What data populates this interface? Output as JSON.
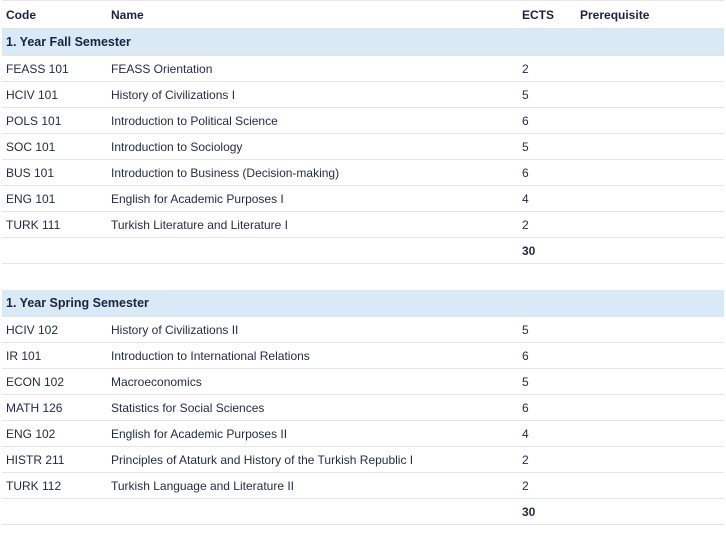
{
  "table": {
    "headers": {
      "code": "Code",
      "name": "Name",
      "ects": "ECTS",
      "prerequisite": "Prerequisite"
    },
    "semesters": [
      {
        "title": "1. Year Fall Semester",
        "courses": [
          {
            "code": "FEASS 101",
            "name": "FEASS Orientation",
            "ects": "2",
            "prerequisite": ""
          },
          {
            "code": "HCIV 101",
            "name": "History of Civilizations I",
            "ects": "5",
            "prerequisite": ""
          },
          {
            "code": "POLS 101",
            "name": "Introduction to Political Science",
            "ects": "6",
            "prerequisite": ""
          },
          {
            "code": "SOC 101",
            "name": "Introduction to Sociology",
            "ects": "5",
            "prerequisite": ""
          },
          {
            "code": "BUS 101",
            "name": "Introduction to Business (Decision-making)",
            "ects": "6",
            "prerequisite": ""
          },
          {
            "code": "ENG 101",
            "name": "English for Academic Purposes I",
            "ects": "4",
            "prerequisite": ""
          },
          {
            "code": "TURK 111",
            "name": "Turkish Literature and Literature I",
            "ects": "2",
            "prerequisite": ""
          }
        ],
        "total_ects": "30"
      },
      {
        "title": "1. Year Spring Semester",
        "courses": [
          {
            "code": "HCIV 102",
            "name": "History of Civilizations II",
            "ects": "5",
            "prerequisite": ""
          },
          {
            "code": "IR 101",
            "name": "Introduction to International Relations",
            "ects": "6",
            "prerequisite": ""
          },
          {
            "code": "ECON 102",
            "name": "Macroeconomics",
            "ects": "5",
            "prerequisite": ""
          },
          {
            "code": "MATH 126",
            "name": "Statistics for Social Sciences",
            "ects": "6",
            "prerequisite": ""
          },
          {
            "code": "ENG 102",
            "name": "English for Academic Purposes II",
            "ects": "4",
            "prerequisite": ""
          },
          {
            "code": "HISTR 211",
            "name": "Principles of Ataturk and History of the Turkish Republic I",
            "ects": "2",
            "prerequisite": ""
          },
          {
            "code": "TURK 112",
            "name": "Turkish Language and Literature II",
            "ects": "2",
            "prerequisite": ""
          }
        ],
        "total_ects": "30"
      }
    ]
  }
}
